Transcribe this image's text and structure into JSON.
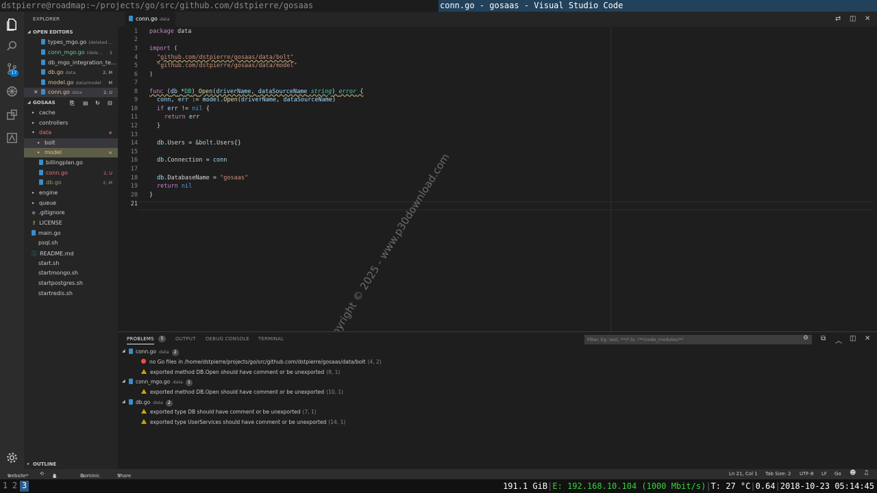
{
  "window": {
    "terminal_title": "dstpierre@roadmap:~/projects/go/src/github.com/dstpierre/gosaas",
    "app_title": "conn.go - gosaas - Visual Studio Code"
  },
  "activity_bar": {
    "scm_badge": "17"
  },
  "sidebar": {
    "title": "EXPLORER",
    "open_editors_title": "OPEN EDITORS",
    "open_editors": [
      {
        "name": "types_mgo.go",
        "desc": "(deleted ...",
        "status": ""
      },
      {
        "name": "conn_mgo.go",
        "desc": "(dele...",
        "status": "1"
      },
      {
        "name": "db_mgo_integration_te...",
        "desc": "",
        "status": ""
      },
      {
        "name": "db.go",
        "desc": "data",
        "status": "2, M"
      },
      {
        "name": "model.go",
        "desc": "data/model",
        "status": "M"
      },
      {
        "name": "conn.go",
        "desc": "data",
        "status": "2, U"
      }
    ],
    "folder_title": "GOSAAS",
    "tree": [
      {
        "name": "cache",
        "status": ""
      },
      {
        "name": "controllers",
        "status": ""
      },
      {
        "name": "data",
        "status": ""
      },
      {
        "name": "bolt",
        "status": ""
      },
      {
        "name": "model",
        "status": ""
      },
      {
        "name": "billingplan.go",
        "status": ""
      },
      {
        "name": "conn.go",
        "status": "2, U"
      },
      {
        "name": "db.go",
        "status": "2, M"
      },
      {
        "name": "engine",
        "status": ""
      },
      {
        "name": "queue",
        "status": ""
      },
      {
        "name": ".gitignore",
        "status": ""
      },
      {
        "name": "LICENSE",
        "status": ""
      },
      {
        "name": "main.go",
        "status": ""
      },
      {
        "name": "psql.sh",
        "status": ""
      },
      {
        "name": "README.md",
        "status": ""
      },
      {
        "name": "start.sh",
        "status": ""
      },
      {
        "name": "startmongo.sh",
        "status": ""
      },
      {
        "name": "startpostgres.sh",
        "status": ""
      },
      {
        "name": "startredis.sh",
        "status": ""
      }
    ],
    "outline_title": "OUTLINE"
  },
  "editor": {
    "tab_name": "conn.go",
    "tab_desc": "data",
    "line_numbers": [
      "1",
      "2",
      "3",
      "4",
      "5",
      "6",
      "7",
      "8",
      "9",
      "10",
      "11",
      "12",
      "13",
      "14",
      "15",
      "16",
      "17",
      "18",
      "19",
      "20",
      "21"
    ],
    "code": {
      "l1_kw": "package",
      "l1_name": " data",
      "l3_kw": "import",
      "l3_rest": " (",
      "l4": "\"github.com/dstpierre/gosaas/data/bolt\"",
      "l5": "\"github.com/dstpierre/gosaas/data/model\"",
      "l6": ")",
      "l8_kw": "func",
      "l8_a": " (",
      "l8_db": "db",
      "l8_b": " *",
      "l8_DB": "DB",
      "l8_c": ") ",
      "l8_fn": "Open",
      "l8_d": "(",
      "l8_p1": "driverName",
      "l8_e": ", ",
      "l8_p2": "dataSourceName",
      "l8_f": " ",
      "l8_t1": "string",
      "l8_g": ") ",
      "l8_t2": "error",
      "l8_h": " {",
      "l9_a": "conn",
      "l9_b": ", ",
      "l9_c": "err",
      "l9_d": " := ",
      "l9_e": "model",
      "l9_f": ".",
      "l9_fn": "Open",
      "l9_g": "(",
      "l9_h": "driverName",
      "l9_i": ", ",
      "l9_j": "dataSourceName",
      "l9_k": ")",
      "l10_kw": "if",
      "l10_a": " err",
      "l10_b": " != ",
      "l10_nil": "nil",
      "l10_c": " {",
      "l11_kw": "return",
      "l11_a": " err",
      "l12": "}",
      "l14_a": "db",
      "l14_b": ".Users = ",
      "l14_c": "&",
      "l14_d": "bolt",
      "l14_e": ".Users{}",
      "l16_a": "db",
      "l16_b": ".Connection = ",
      "l16_c": "conn",
      "l18_a": "db",
      "l18_b": ".DatabaseName = ",
      "l18_c": "\"gosaas\"",
      "l19_kw": "return",
      "l19_nil": " nil",
      "l20": "}"
    }
  },
  "watermark": "Copyright © 2025 - www.p30download.com",
  "panel": {
    "tabs": [
      "PROBLEMS",
      "OUTPUT",
      "DEBUG CONSOLE",
      "TERMINAL"
    ],
    "problems_count": "5",
    "filter_placeholder": "Filter. Eg: text, **/*.ts, !**/node_modules/**",
    "groups": [
      {
        "file": "conn.go",
        "desc": "data",
        "count": "2"
      },
      {
        "file": "conn_mgo.go",
        "desc": "data",
        "count": "1"
      },
      {
        "file": "db.go",
        "desc": "data",
        "count": "2"
      }
    ],
    "problems": [
      {
        "msg": "no Go files in /home/dstpierre/projects/go/src/github.com/dstpierre/gosaas/data/bolt",
        "loc": "(4, 2)"
      },
      {
        "msg": "exported method DB.Open should have comment or be unexported",
        "loc": "(8, 1)"
      },
      {
        "msg": "exported method DB.Open should have comment or be unexported",
        "loc": "(10, 1)"
      },
      {
        "msg": "exported type DB should have comment or be unexported",
        "loc": "(7, 1)"
      },
      {
        "msg": "exported type UserServices should have comment or be unexported",
        "loc": "(14, 1)"
      }
    ]
  },
  "statusbar": {
    "branch": "website*",
    "errors": "1",
    "warnings": "4",
    "user": "Dominic",
    "share": "Share",
    "position": "Ln 21, Col 1",
    "tab_size": "Tab Size: 2",
    "encoding": "UTF-8",
    "eol": "LF",
    "language": "Go"
  },
  "sysbar": {
    "workspaces": [
      "1",
      "2",
      "3"
    ],
    "disk": "191.1 GiB",
    "ip": "E: 192.168.10.104 (1000 Mbit/s)",
    "temp": "T: 27 °C",
    "load": "0.64",
    "datetime": "2018-10-23 05:14:45"
  }
}
